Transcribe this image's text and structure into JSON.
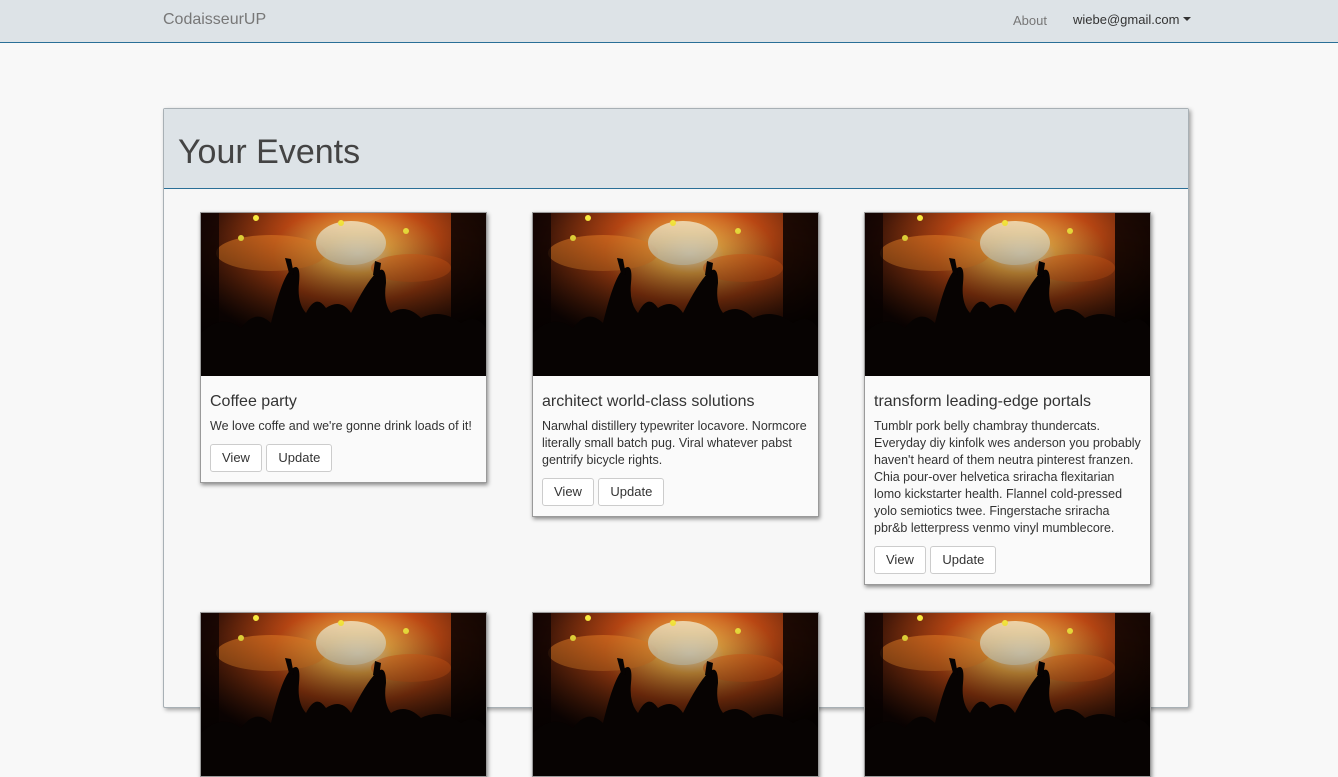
{
  "navbar": {
    "brand": "CodaisseurUP",
    "about": "About",
    "user_email": "wiebe@gmail.com"
  },
  "panel": {
    "title": "Your Events"
  },
  "events": [
    {
      "title": "Coffee party",
      "description": "We love coffe and we're gonne drink loads of it!",
      "view_label": "View",
      "update_label": "Update"
    },
    {
      "title": "architect world-class solutions",
      "description": "Narwhal distillery typewriter locavore. Normcore literally small batch pug. Viral whatever pabst gentrify bicycle rights.",
      "view_label": "View",
      "update_label": "Update"
    },
    {
      "title": "transform leading-edge portals",
      "description": "Tumblr pork belly chambray thundercats. Everyday diy kinfolk wes anderson you probably haven't heard of them neutra pinterest franzen. Chia pour-over helvetica sriracha flexitarian lomo kickstarter health. Flannel cold-pressed yolo semiotics twee. Fingerstache sriracha pbr&b letterpress venmo vinyl mumblecore.",
      "view_label": "View",
      "update_label": "Update"
    }
  ],
  "colors": {
    "navbar_bg": "#dde3e7",
    "accent_border": "#2a6f97"
  }
}
